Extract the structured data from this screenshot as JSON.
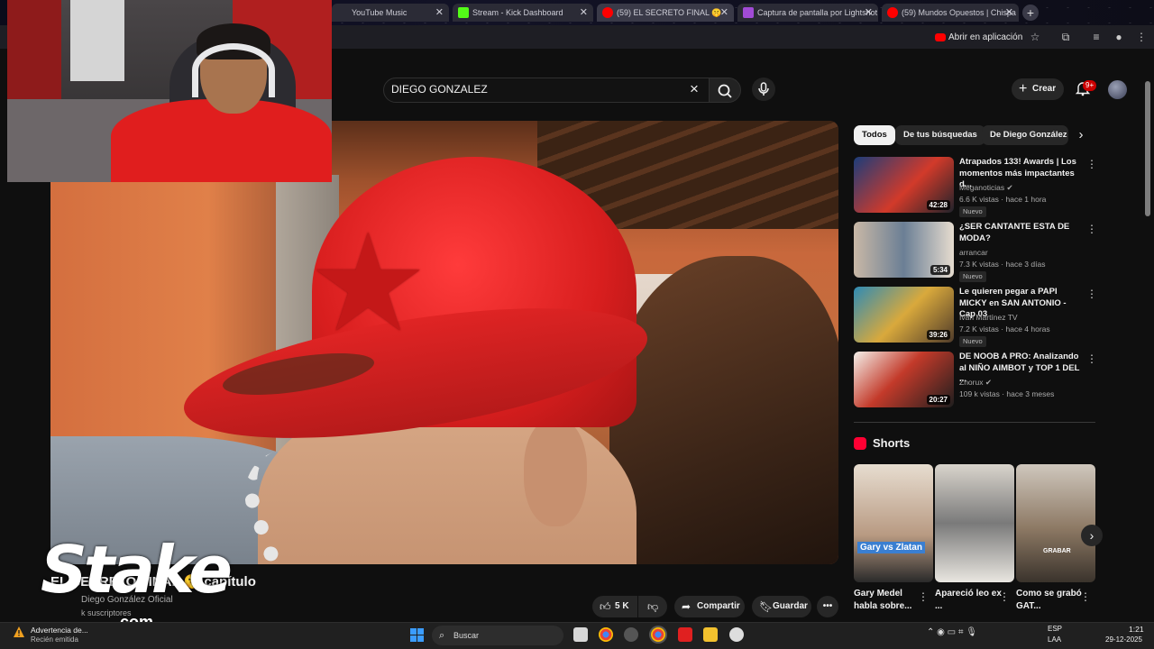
{
  "browser": {
    "tabs": [
      {
        "label": "YouTube Music",
        "favicon_color": "#ff0000"
      },
      {
        "label": "Stream - Kick Dashboard",
        "favicon_color": "#53fc18"
      },
      {
        "label": "(59) EL SECRETO FINAL 🤫",
        "favicon_color": "#ff0000"
      },
      {
        "label": "Captura de pantalla por Lightshot",
        "favicon_color": "#a14bd6"
      },
      {
        "label": "(59) Mundos Opuestos | Chispa",
        "favicon_color": "#ff0000"
      }
    ],
    "open_in_app": "Abrir en aplicación"
  },
  "youtube": {
    "search_query": "DIEGO GONZALEZ",
    "create_label": "Crear",
    "notif_count": "9+"
  },
  "video": {
    "title": "EL SECRETO FINAL 🤫 capítulo",
    "channel": "Diego González Oficial",
    "subscribers": "k suscriptores",
    "likes": "5 K",
    "share": "Compartir",
    "save": "Guardar"
  },
  "overlay": {
    "logo_word": "Stake",
    "logo_domain": ".com"
  },
  "chips": [
    "Todos",
    "De tus búsquedas",
    "De Diego González"
  ],
  "recommended": [
    {
      "title": "Atrapados 133! Awards | Los momentos más impactantes d...",
      "channel": "Meganoticias ✔",
      "meta": "6.6 K vistas · hace 1 hora",
      "badge": "Nuevo",
      "duration": "42:28"
    },
    {
      "title": "¿SER CANTANTE ESTA DE MODA?",
      "channel": "arrancar",
      "meta": "7.3 K vistas · hace 3 días",
      "badge": "Nuevo",
      "duration": "5:34"
    },
    {
      "title": "Le quieren pegar a PAPI MICKY en SAN ANTONIO - Cap 03",
      "channel": "Iván Martínez TV",
      "meta": "7.2 K vistas · hace 4 horas",
      "badge": "Nuevo",
      "duration": "39:26"
    },
    {
      "title": "DE NOOB A PRO: Analizando al NIÑO AIMBOT y TOP 1 DEL ...",
      "channel": "Znorux ✔",
      "meta": "109 k vistas · hace 3 meses",
      "badge": "",
      "duration": "20:27"
    }
  ],
  "shorts": {
    "heading": "Shorts",
    "items": [
      {
        "title": "Gary Medel habla sobre...",
        "thumb_text": "Gary vs Zlatan"
      },
      {
        "title": "Apareció leo ex ...",
        "thumb_text": ""
      },
      {
        "title": "Como se grabó GAT...",
        "thumb_text": "GRABAR"
      }
    ]
  },
  "taskbar": {
    "notif_title": "Advertencia de...",
    "notif_sub": "Recién emitida",
    "search_placeholder": "Buscar",
    "lang1": "ESP",
    "lang2": "LAA",
    "time": "1:21",
    "date": "29-12-2025"
  }
}
